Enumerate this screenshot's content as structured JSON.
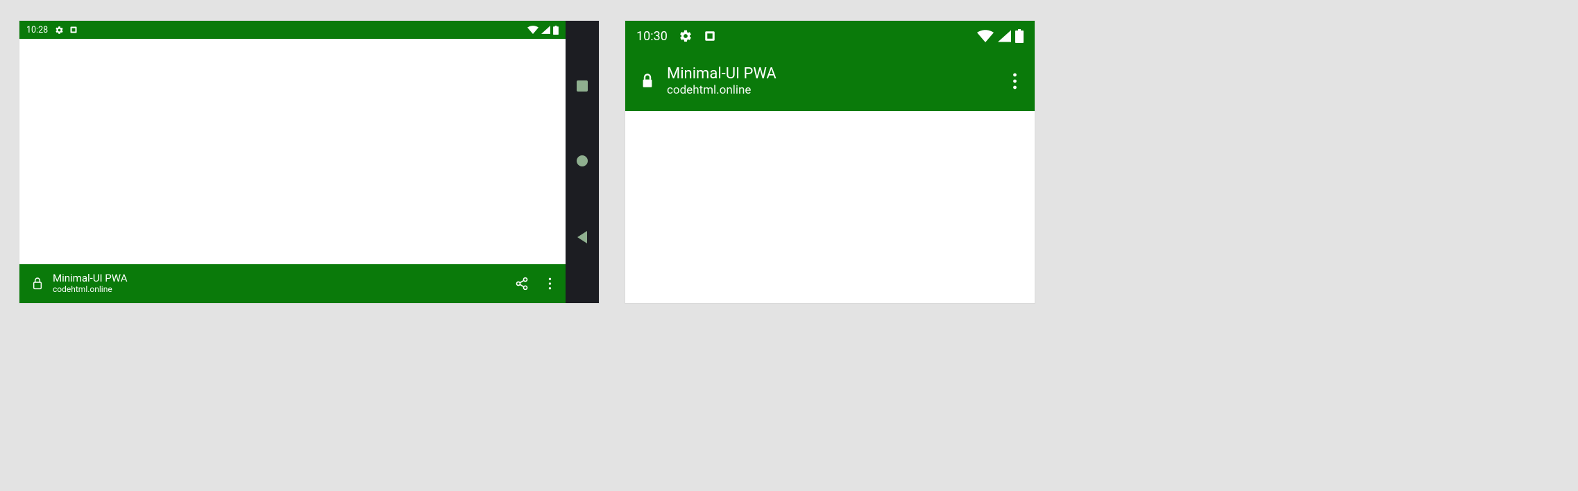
{
  "colors": {
    "accent": "#0a7a0a",
    "navbar": "#1c1d22",
    "navBtn": "#8faf8f"
  },
  "device1": {
    "status": {
      "clock": "10:28"
    },
    "bottom": {
      "title": "Minimal-UI PWA",
      "host": "codehtml.online"
    }
  },
  "device2": {
    "status": {
      "clock": "10:30"
    },
    "appbar": {
      "title": "Minimal-UI PWA",
      "host": "codehtml.online"
    }
  }
}
